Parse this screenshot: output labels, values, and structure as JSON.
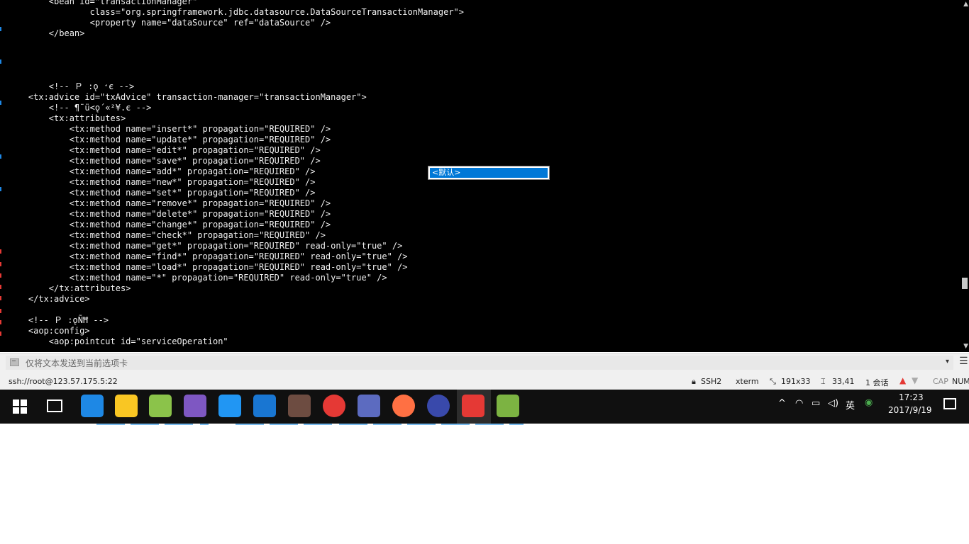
{
  "terminal": {
    "lines": [
      "        <bean id=\"transactionManager\"",
      "                class=\"org.springframework.jdbc.datasource.DataSourceTransactionManager\">",
      "                <property name=\"dataSource\" ref=\"dataSource\" />",
      "        </bean>",
      "",
      "",
      "",
      "",
      "        <!-- Ｐ :ǫ ̛є -->",
      "    <tx:advice id=\"txAdvice\" transaction-manager=\"transactionManager\">",
      "        <!-- ¶¨ü<ǫ´«²¥.є -->",
      "        <tx:attributes>",
      "            <tx:method name=\"insert*\" propagation=\"REQUIRED\" />",
      "            <tx:method name=\"update*\" propagation=\"REQUIRED\" />",
      "            <tx:method name=\"edit*\" propagation=\"REQUIRED\" />",
      "            <tx:method name=\"save*\" propagation=\"REQUIRED\" />",
      "            <tx:method name=\"add*\" propagation=\"REQUIRED\" />",
      "            <tx:method name=\"new*\" propagation=\"REQUIRED\" />",
      "            <tx:method name=\"set*\" propagation=\"REQUIRED\" />",
      "            <tx:method name=\"remove*\" propagation=\"REQUIRED\" />",
      "            <tx:method name=\"delete*\" propagation=\"REQUIRED\" />",
      "            <tx:method name=\"change*\" propagation=\"REQUIRED\" />",
      "            <tx:method name=\"check*\" propagation=\"REQUIRED\" />",
      "            <tx:method name=\"get*\" propagation=\"REQUIRED\" read-only=\"true\" />",
      "            <tx:method name=\"find*\" propagation=\"REQUIRED\" read-only=\"true\" />",
      "            <tx:method name=\"load*\" propagation=\"REQUIRED\" read-only=\"true\" />",
      "            <tx:method name=\"*\" propagation=\"REQUIRED\" read-only=\"true\" />",
      "        </tx:attributes>",
      "    </tx:advice>",
      "",
      "    <!-- Ｐ :ǫÑĦ -->",
      "    <aop:config>",
      "        <aop:pointcut id=\"serviceOperation\""
    ]
  },
  "ime": {
    "candidate": "<默认>"
  },
  "send_bar": {
    "placeholder": "仅将文本发送到当前选项卡"
  },
  "status_bar": {
    "connection": "ssh://root@123.57.175.5:22",
    "protocol": "SSH2",
    "terminal_type": "xterm",
    "size": "191x33",
    "cursor_position": "33,41",
    "sessions": "1 会话",
    "cap": "CAP",
    "num": "NUM"
  },
  "taskbar": {
    "apps": [
      {
        "name": "edge-browser-icon",
        "color": "#1e88e5"
      },
      {
        "name": "file-explorer-icon",
        "color": "#f9c623"
      },
      {
        "name": "notepad-plus-icon",
        "color": "#8bc34a"
      },
      {
        "name": "paint-icon",
        "color": "#7e57c2"
      },
      {
        "name": "baidu-netdisk-icon",
        "color": "#2196f3"
      },
      {
        "name": "ie-browser-icon",
        "color": "#1976d2"
      },
      {
        "name": "film-app-icon",
        "color": "#6d4c41"
      },
      {
        "name": "chrome-browser-icon",
        "color": "#e53935"
      },
      {
        "name": "shark-app-icon",
        "color": "#5c6bc0"
      },
      {
        "name": "firefox-browser-icon",
        "color": "#ff7043"
      },
      {
        "name": "eclipse-icon",
        "color": "#3949ab"
      },
      {
        "name": "xshell-icon",
        "color": "#e53935"
      },
      {
        "name": "xftp-icon",
        "color": "#7cb342"
      }
    ],
    "ime_language": "英",
    "clock_time": "17:23",
    "clock_date": "2017/9/19"
  },
  "colors": {
    "terminal_bg": "#000000",
    "terminal_fg": "#f0f0f0",
    "ime_highlight": "#0078d7",
    "taskbar_bg": "#101010",
    "taskbar_indicator": "#76b9ed",
    "upload_arrow": "#e53935"
  }
}
